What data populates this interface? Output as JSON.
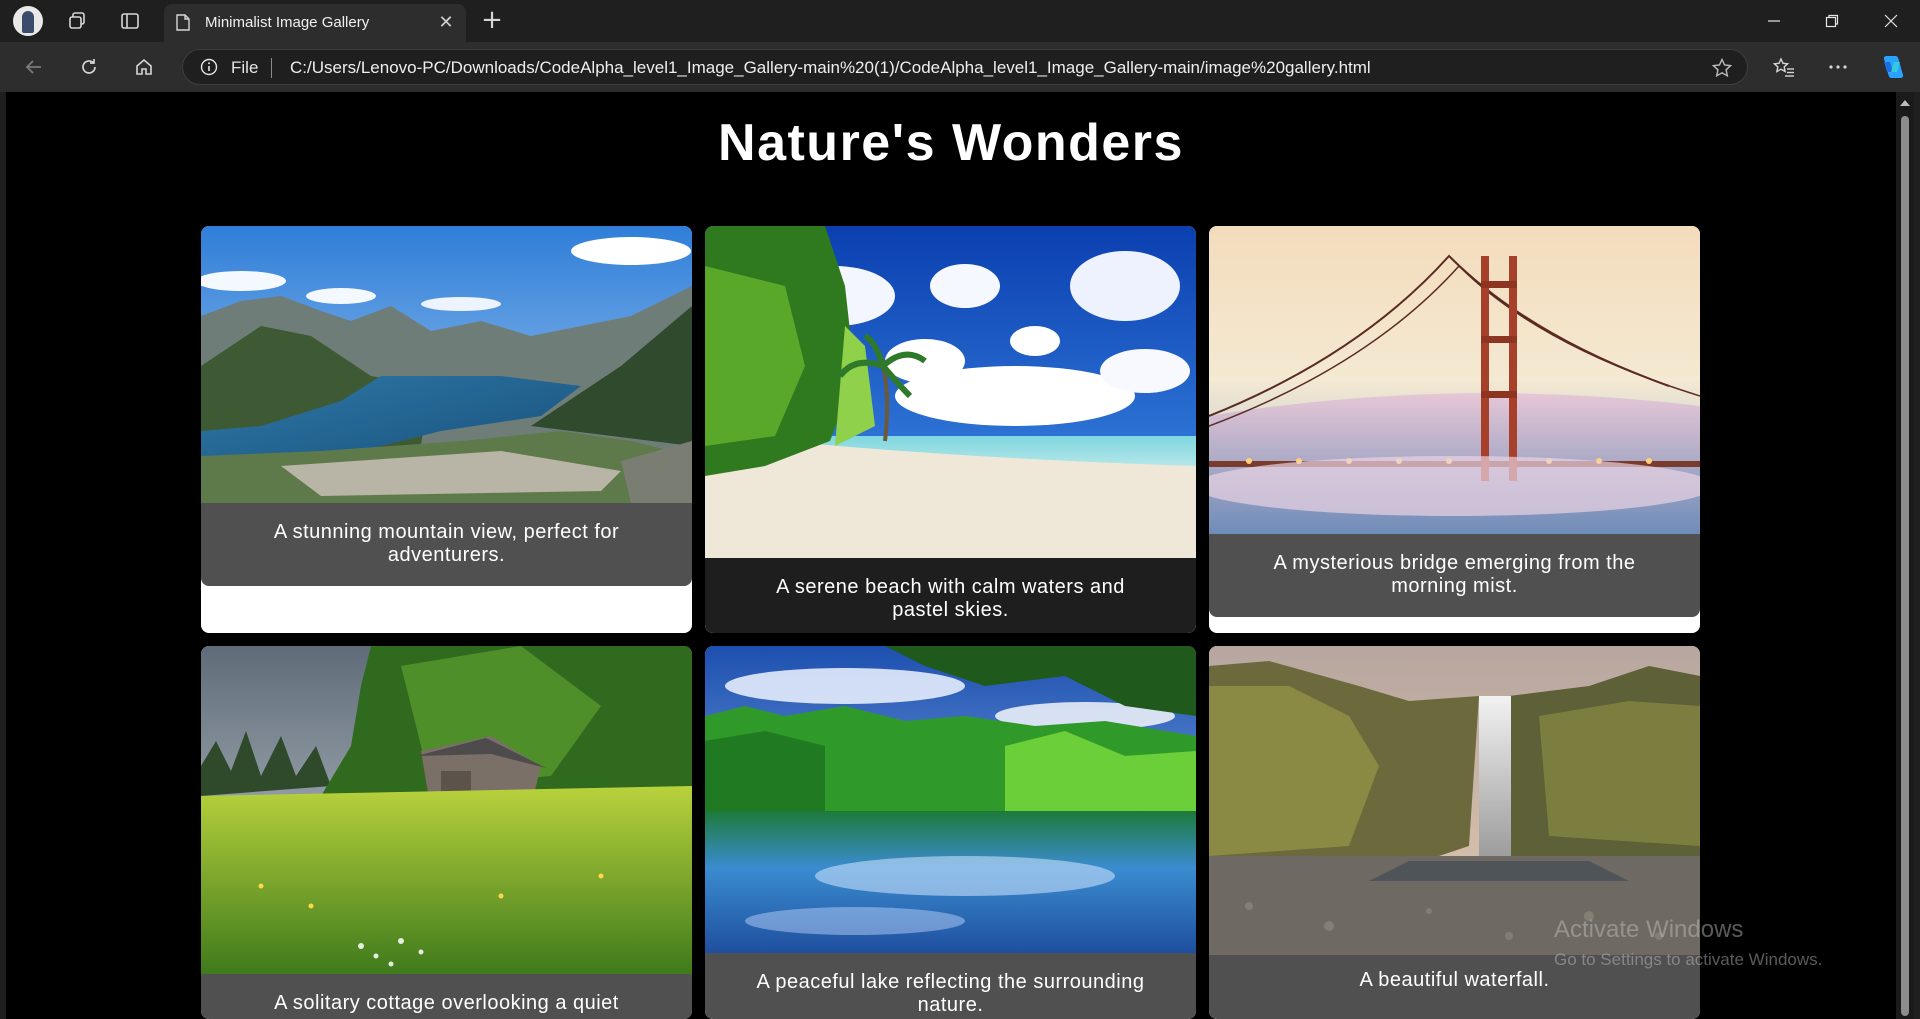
{
  "browser": {
    "tab_title": "Minimalist Image Gallery",
    "address_scheme": "File",
    "address_url": "C:/Users/Lenovo-PC/Downloads/CodeAlpha_level1_Image_Gallery-main%20(1)/CodeAlpha_level1_Image_Gallery-main/image%20gallery.html",
    "icons": [
      "profile-avatar",
      "workspaces-icon",
      "tab-actions-icon",
      "page-icon",
      "close-icon",
      "plus-icon",
      "minimize-icon",
      "maximize-icon",
      "close-window-icon",
      "back-arrow-icon",
      "reload-icon",
      "home-icon",
      "info-icon",
      "star-icon",
      "favorites-icon",
      "more-icon",
      "copilot-icon"
    ],
    "theme": {
      "chrome_dark": "#1f1f1f",
      "tab_active": "#2d2d2d",
      "copilot_blue": "#2aa3ff"
    }
  },
  "page": {
    "heading": "Nature's Wonders",
    "background": "#000000",
    "card_caption_bg": "#505050",
    "cards": [
      {
        "caption": "A stunning mountain view, perfect for adventurers.",
        "image": "mountain-lake-photo"
      },
      {
        "caption": "A serene beach with calm waters and pastel skies.",
        "image": "tropical-beach-photo"
      },
      {
        "caption": "A mysterious bridge emerging from the morning mist.",
        "image": "golden-gate-bridge-fog-photo"
      },
      {
        "caption": "A solitary cottage overlooking a quiet",
        "image": "meadow-cottage-photo"
      },
      {
        "caption": "A peaceful lake reflecting the surrounding nature.",
        "image": "reflecting-lake-photo"
      },
      {
        "caption": "A beautiful waterfall.",
        "image": "waterfall-cliffs-photo"
      }
    ]
  },
  "os_watermark": {
    "line1": "Activate Windows",
    "line2": "Go to Settings to activate Windows."
  }
}
